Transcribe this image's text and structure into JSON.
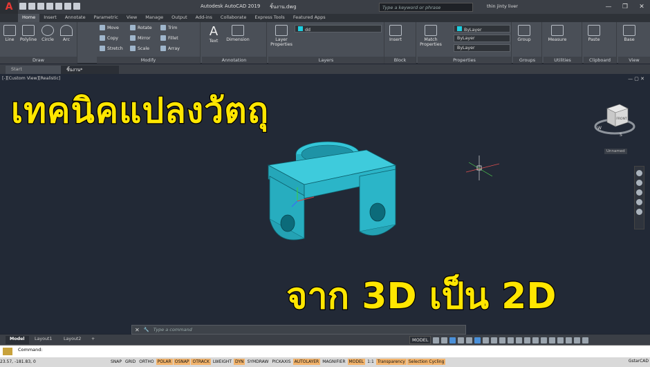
{
  "app": {
    "logo_letter": "A",
    "title": "Autodesk AutoCAD 2019",
    "filename": "ชิ้นงาน.dwg",
    "search_placeholder": "Type a keyword or phrase",
    "user": "thin jinty liver",
    "badge": "30"
  },
  "ribbon_tabs": [
    "Home",
    "Insert",
    "Annotate",
    "Parametric",
    "View",
    "Manage",
    "Output",
    "Add-ins",
    "Collaborate",
    "Express Tools",
    "Featured Apps"
  ],
  "panels": {
    "draw": {
      "label": "Draw",
      "tools": [
        "Line",
        "Polyline",
        "Circle",
        "Arc"
      ]
    },
    "modify": {
      "label": "Modify",
      "tools": [
        "Move",
        "Rotate",
        "Trim",
        "Copy",
        "Mirror",
        "Fillet",
        "Stretch",
        "Scale",
        "Array"
      ]
    },
    "annotation": {
      "label": "Annotation",
      "tools": [
        "Text",
        "Dimension"
      ]
    },
    "layers": {
      "label": "Layers",
      "tool": "Layer Properties",
      "layer_value": "dd"
    },
    "block": {
      "label": "Block",
      "tool": "Insert"
    },
    "properties": {
      "label": "Properties",
      "tool": "Match Properties",
      "bylayer1": "ByLayer",
      "bylayer2": "ByLayer",
      "bylayer3": "ByLayer"
    },
    "groups": {
      "label": "Groups",
      "tool": "Group"
    },
    "utilities": {
      "label": "Utilities",
      "tool": "Measure"
    },
    "clipboard": {
      "label": "Clipboard",
      "tool": "Paste"
    },
    "view": {
      "label": "View",
      "tool": "Base"
    }
  },
  "file_tabs": {
    "start": "Start",
    "doc": "ชิ้นงาน*"
  },
  "viewport": {
    "label": "[-][Custom View][Realistic]",
    "title_thai": "เทคนิคแปลงวัตถุ",
    "subtitle_thai": "จาก 3D เป็น 2D",
    "viewcube_face": "FRONT",
    "unnamed": "Unnamed",
    "compass_w": "W",
    "compass_s": "S"
  },
  "cmdline": {
    "placeholder": "Type a command"
  },
  "layout_tabs": [
    "Model",
    "Layout1",
    "Layout2"
  ],
  "status": {
    "model": "MODEL",
    "cmd_history": "Command:",
    "coords": "23.57, -181.83, 0",
    "items": [
      "SNAP",
      "GRID",
      "ORTHO",
      "POLAR",
      "OSNAP",
      "OTRACK",
      "LWEIGHT",
      "DYN",
      "SYMDRAW",
      "PICKAXIS",
      "AUTOLAYER",
      "MAGNIFIER",
      "MODEL",
      "1:1",
      "Transparency",
      "Selection Cycling"
    ],
    "right_text": "GstarCAD"
  },
  "colors": {
    "accent": "#ffe600",
    "object": "#2bb5c8",
    "viewport_bg": "#222936"
  }
}
